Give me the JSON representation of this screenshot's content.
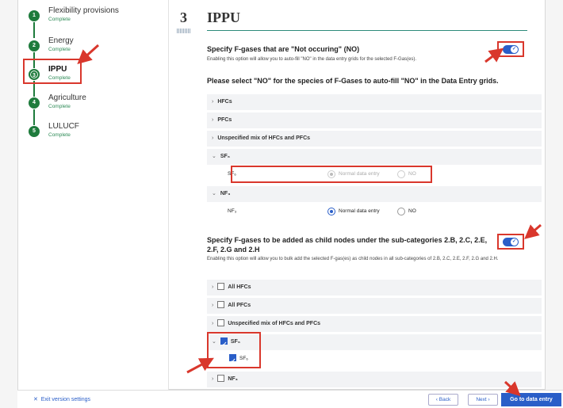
{
  "sidebar": {
    "steps": [
      {
        "num": "1",
        "name": "Flexibility provisions",
        "status": "Complete"
      },
      {
        "num": "2",
        "name": "Energy",
        "status": "Complete"
      },
      {
        "num": "3",
        "name": "IPPU",
        "status": "Complete"
      },
      {
        "num": "4",
        "name": "Agriculture",
        "status": "Complete"
      },
      {
        "num": "5",
        "name": "LULUCF",
        "status": "Complete"
      }
    ]
  },
  "section": {
    "number": "3",
    "title": "IPPU"
  },
  "question1": {
    "title": "Specify F-gases that are \"Not occuring\" (NO)",
    "description": "Enabling this option will allow you to auto-fill \"NO\" in the data entry grids for the selected F-Gas(es).",
    "toggle_on": true
  },
  "no_section": {
    "heading": "Please select \"NO\" for the species of F-Gases to auto-fill \"NO\" in the Data Entry grids.",
    "groups": [
      {
        "label": "HFCs"
      },
      {
        "label": "PFCs"
      },
      {
        "label": "Unspecified mix of HFCs and PFCs"
      },
      {
        "label": "SF₆",
        "row_label": "SF₆",
        "opt1": "Normal data entry",
        "opt2": "NO"
      },
      {
        "label": "NF₃",
        "row_label": "NF₃",
        "opt1": "Normal data entry",
        "opt2": "NO"
      }
    ]
  },
  "question2": {
    "title": "Specify F-gases to be added as child nodes under the sub-categories 2.B, 2.C, 2.E, 2.F, 2.G and 2.H",
    "description": "Enabling this option will allow you to bulk add the selected F-gas(es) as child nodes in all sub-categories of 2.B, 2.C, 2.E, 2.F, 2.G and 2.H.",
    "toggle_on": true
  },
  "child_section": {
    "groups": [
      {
        "label": "All HFCs",
        "checked": false
      },
      {
        "label": "All PFCs",
        "checked": false
      },
      {
        "label": "Unspecified mix of HFCs and PFCs",
        "checked": false
      },
      {
        "label": "SF₆",
        "checked": true,
        "child": "SF₆"
      },
      {
        "label": "NF₃",
        "checked": false
      }
    ]
  },
  "footer": {
    "exit_label": "Exit version settings",
    "back_label": "Back",
    "next_label": "Next",
    "go_label": "Go to data entry"
  },
  "colors": {
    "accent": "#2a5ec8",
    "step_complete": "#1e7b3c",
    "annotation": "#d9372c"
  },
  "icons": [
    "close-icon",
    "chevron-right-icon",
    "chevron-down-icon",
    "chevron-left-icon",
    "check-icon"
  ]
}
